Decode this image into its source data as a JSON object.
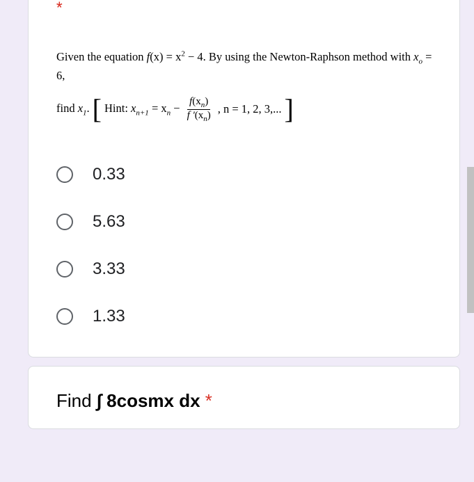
{
  "question1": {
    "required_marker": "*",
    "text_part1": "Given the equation ",
    "text_fx": "f",
    "text_x": "(x)",
    "text_eq": " = x",
    "text_exp": "2",
    "text_minus": " − 4. By using the Newton-Raphson method with ",
    "text_xo": "x",
    "text_xo_sub": "o",
    "text_eq6": " = 6,",
    "hint_find": "find ",
    "hint_x1": "x",
    "hint_x1_sub": "1",
    "hint_dot": ". ",
    "hint_label": "Hint: ",
    "hint_xn1": "x",
    "hint_xn1_sub": "n+1",
    "hint_eq": " = x",
    "hint_xn_sub": "n",
    "hint_minus": " − ",
    "frac_num_f": "f",
    "frac_num_paren": "(x",
    "frac_num_sub": "n",
    "frac_num_close": ")",
    "frac_den_f": "f '",
    "frac_den_paren": "(x",
    "frac_den_sub": "n",
    "frac_den_close": ")",
    "hint_comma": ", n = 1, 2, 3,...",
    "options": [
      "0.33",
      "5.63",
      "3.33",
      "1.33"
    ]
  },
  "question2": {
    "text_find": "Find ",
    "text_integral": "∫ 8cosmx dx",
    "required": " *"
  }
}
